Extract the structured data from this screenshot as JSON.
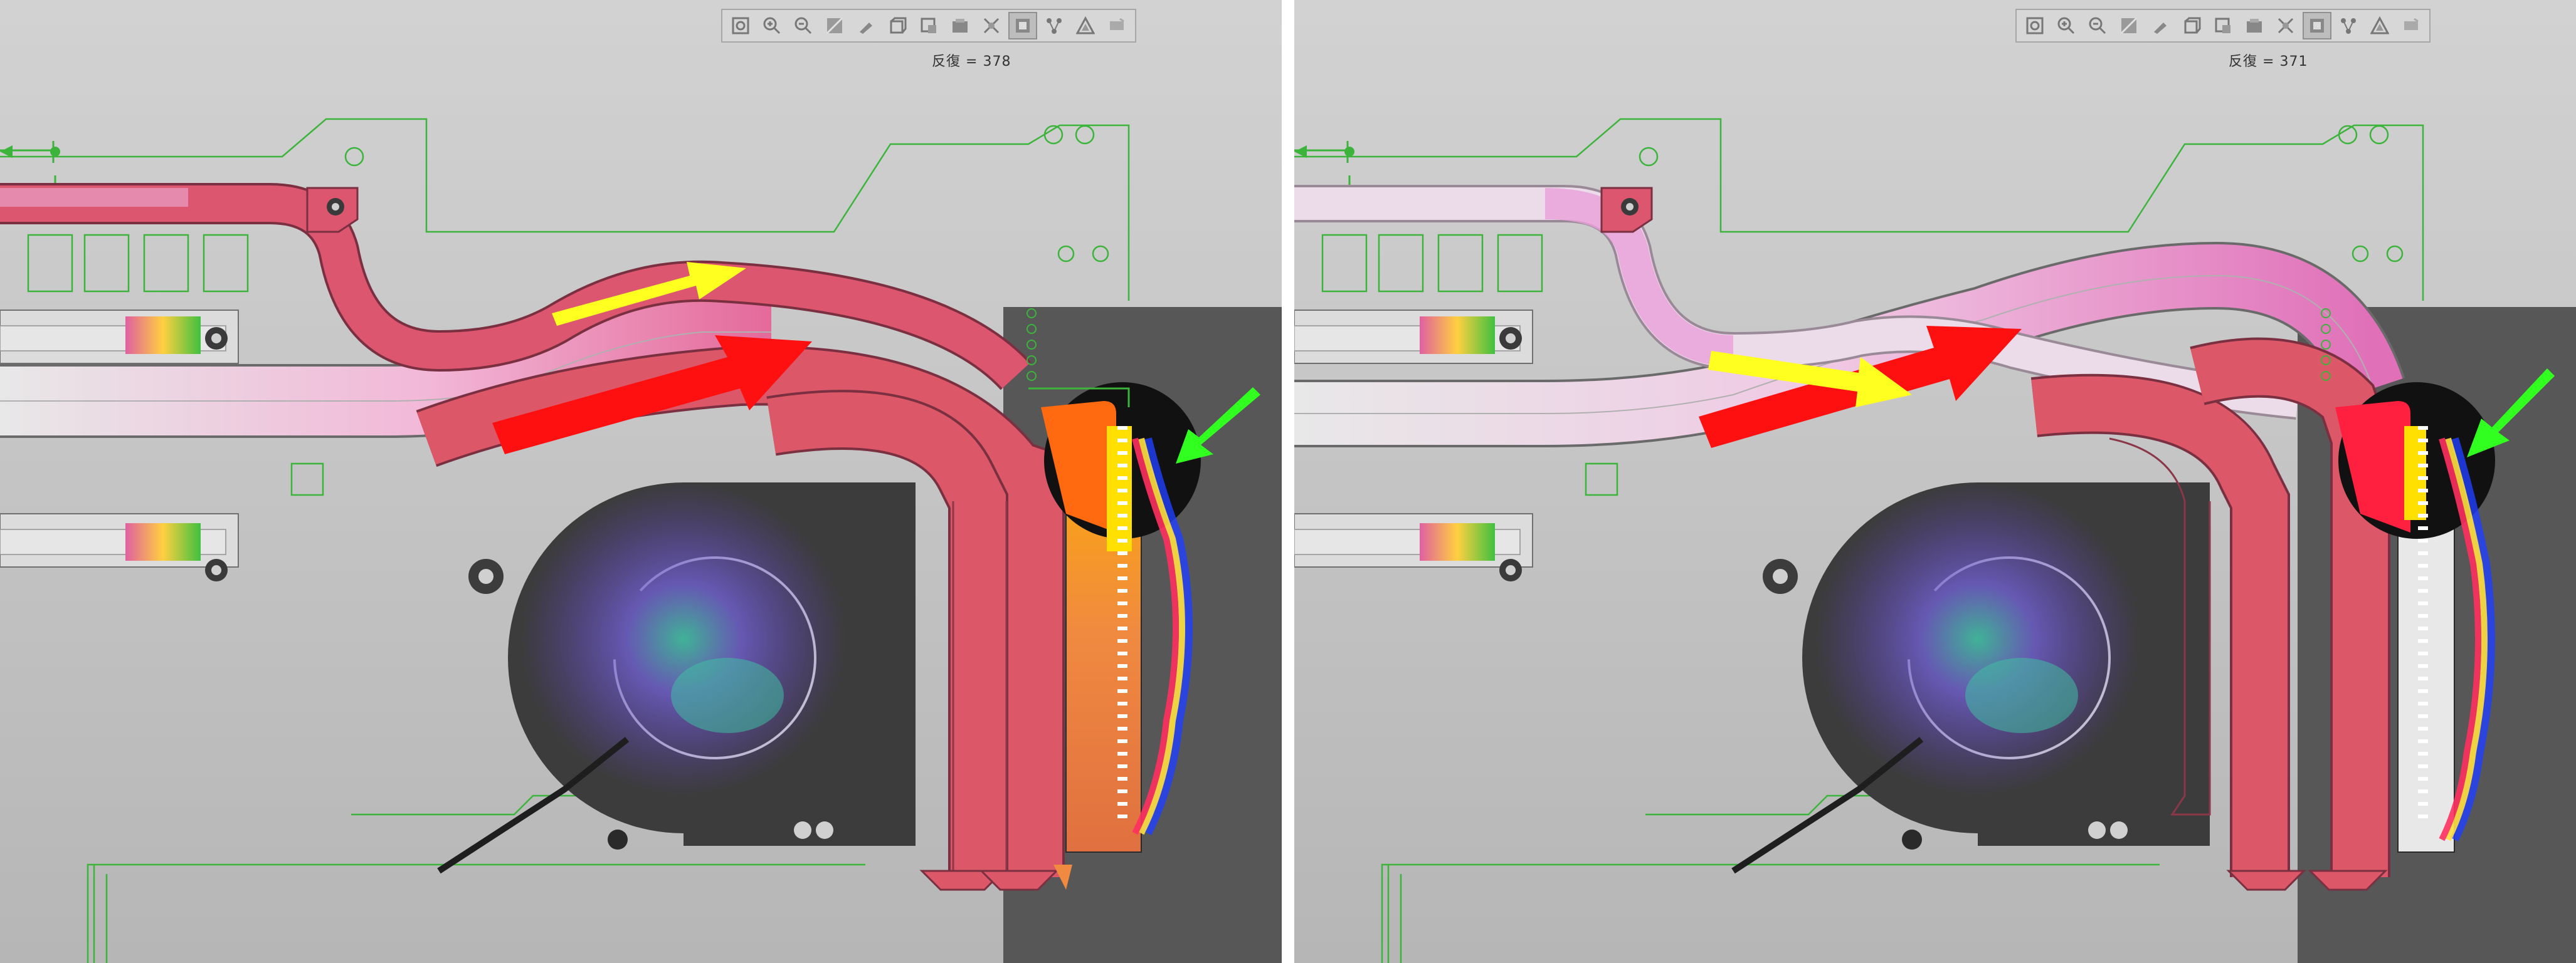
{
  "panels": [
    {
      "iteration": {
        "label": "反復",
        "value": "378"
      },
      "heatpipe_color": "#e0546c",
      "pad_color": "#ff6a10"
    },
    {
      "iteration": {
        "label": "反復",
        "value": "371"
      },
      "heatpipe_color": "#e070b8",
      "pad_color": "#ff2040"
    }
  ],
  "toolbar": {
    "tools": [
      {
        "name": "zoom-fit-icon"
      },
      {
        "name": "zoom-in-icon"
      },
      {
        "name": "zoom-out-icon"
      },
      {
        "name": "zoom-box-icon"
      },
      {
        "name": "pan-icon"
      },
      {
        "name": "view-orientation-icon"
      },
      {
        "name": "section-view-icon"
      },
      {
        "name": "display-style-icon"
      },
      {
        "name": "hide-show-icon"
      },
      {
        "name": "display-mode-icon",
        "active": true
      },
      {
        "name": "measure-icon"
      },
      {
        "name": "mesh-icon"
      },
      {
        "name": "settings-icon"
      }
    ]
  },
  "colors": {
    "background_top": "#cfcfcf",
    "background_bottom": "#b8b8b8",
    "housing": "#575757",
    "fan": "#3a3a3a",
    "outline": "#3cb43c",
    "arrow_red": "#ff1010",
    "arrow_yellow": "#ffff20",
    "arrow_green": "#30ff20"
  }
}
